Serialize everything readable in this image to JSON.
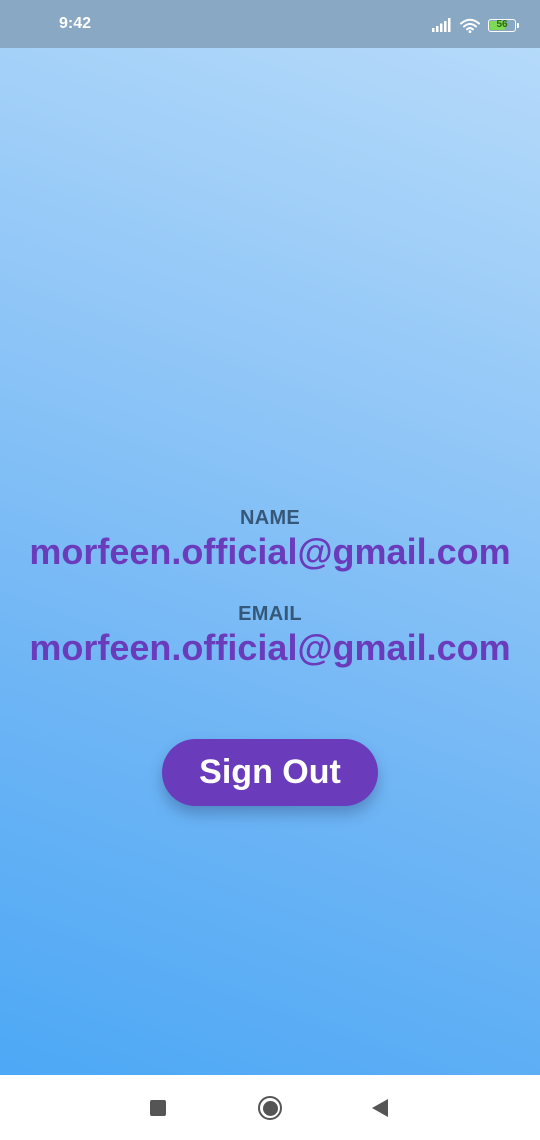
{
  "status_bar": {
    "time": "9:42",
    "battery_level": "56",
    "icons": [
      "signal-icon",
      "wifi-icon",
      "battery-icon"
    ]
  },
  "profile": {
    "name_label": "NAME",
    "name_value": "morfeen.official@gmail.com",
    "email_label": "EMAIL",
    "email_value": "morfeen.official@gmail.com"
  },
  "actions": {
    "sign_out_label": "Sign Out"
  },
  "nav_bar": {
    "icons": [
      "recents-icon",
      "home-icon",
      "back-icon"
    ]
  },
  "colors": {
    "accent": "#6a3cbc",
    "label": "#35587a",
    "status_bar": "#88a8c3",
    "background_top": "#b9dcfa",
    "background_bottom": "#48a6f5"
  }
}
